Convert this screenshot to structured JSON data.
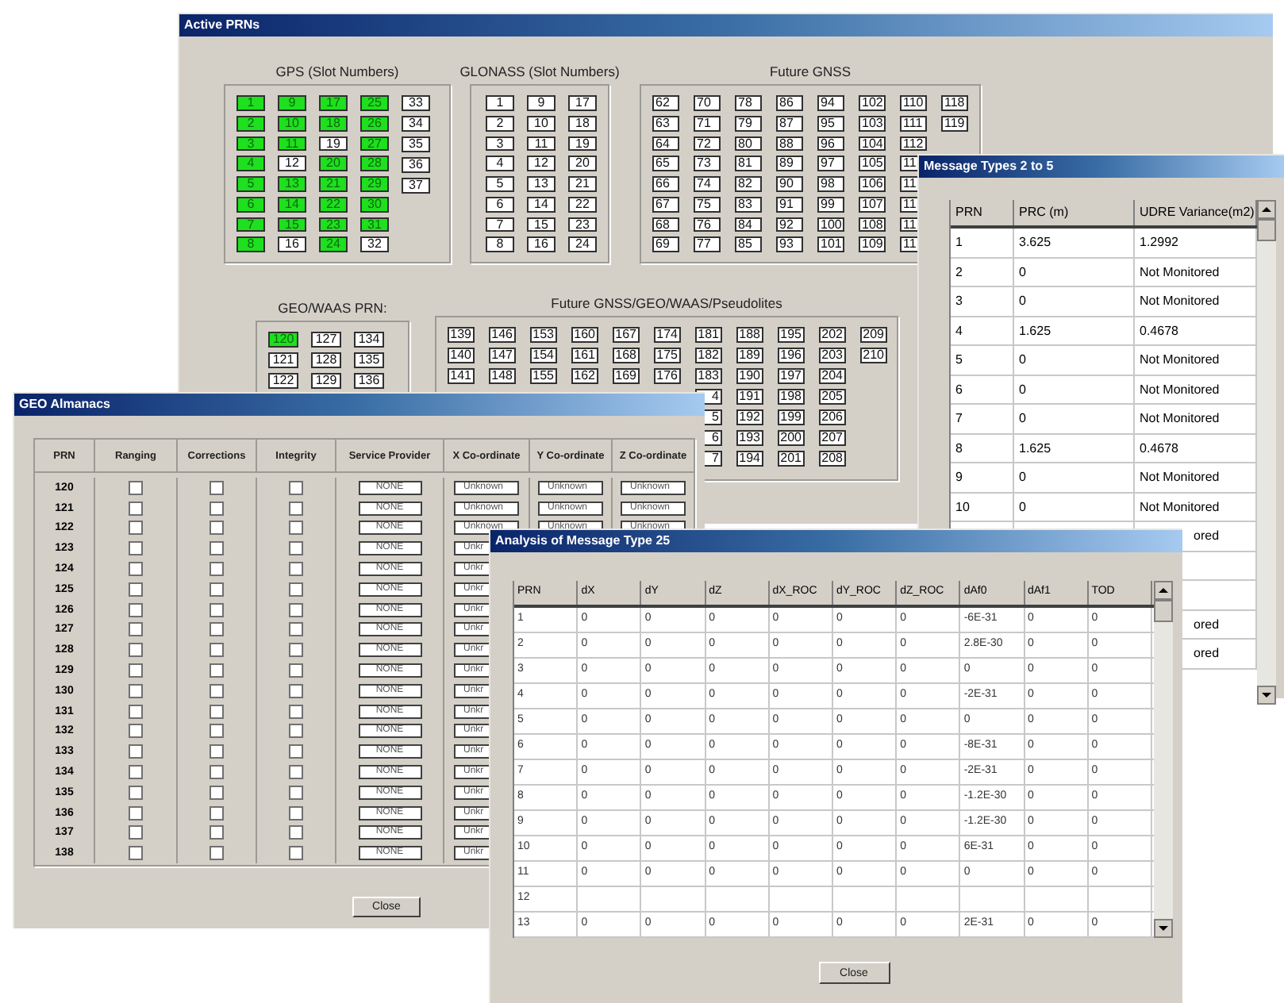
{
  "active_prns": {
    "title": "Active PRNs",
    "top_groups": [
      {
        "label": "GPS (Slot Numbers)",
        "columns": [
          [
            {
              "n": "1",
              "on": true
            },
            {
              "n": "2",
              "on": true
            },
            {
              "n": "3",
              "on": true
            },
            {
              "n": "4",
              "on": true
            },
            {
              "n": "5",
              "on": true
            },
            {
              "n": "6",
              "on": true
            },
            {
              "n": "7",
              "on": true
            },
            {
              "n": "8",
              "on": true
            }
          ],
          [
            {
              "n": "9",
              "on": true
            },
            {
              "n": "10",
              "on": true
            },
            {
              "n": "11",
              "on": true
            },
            {
              "n": "12",
              "on": false
            },
            {
              "n": "13",
              "on": true
            },
            {
              "n": "14",
              "on": true
            },
            {
              "n": "15",
              "on": true
            },
            {
              "n": "16",
              "on": false
            }
          ],
          [
            {
              "n": "17",
              "on": true
            },
            {
              "n": "18",
              "on": true
            },
            {
              "n": "19",
              "on": false
            },
            {
              "n": "20",
              "on": true
            },
            {
              "n": "21",
              "on": true
            },
            {
              "n": "22",
              "on": true
            },
            {
              "n": "23",
              "on": true
            },
            {
              "n": "24",
              "on": true
            }
          ],
          [
            {
              "n": "25",
              "on": true
            },
            {
              "n": "26",
              "on": true
            },
            {
              "n": "27",
              "on": true
            },
            {
              "n": "28",
              "on": true
            },
            {
              "n": "29",
              "on": true
            },
            {
              "n": "30",
              "on": true
            },
            {
              "n": "31",
              "on": true
            },
            {
              "n": "32",
              "on": false
            }
          ],
          [
            {
              "n": "33",
              "on": false
            },
            {
              "n": "34",
              "on": false
            },
            {
              "n": "35",
              "on": false
            },
            {
              "n": "36",
              "on": false
            },
            {
              "n": "37",
              "on": false
            }
          ]
        ]
      },
      {
        "label": "GLONASS (Slot Numbers)",
        "columns": [
          [
            {
              "n": "1",
              "on": false
            },
            {
              "n": "2",
              "on": false
            },
            {
              "n": "3",
              "on": false
            },
            {
              "n": "4",
              "on": false
            },
            {
              "n": "5",
              "on": false
            },
            {
              "n": "6",
              "on": false
            },
            {
              "n": "7",
              "on": false
            },
            {
              "n": "8",
              "on": false
            }
          ],
          [
            {
              "n": "9",
              "on": false
            },
            {
              "n": "10",
              "on": false
            },
            {
              "n": "11",
              "on": false
            },
            {
              "n": "12",
              "on": false
            },
            {
              "n": "13",
              "on": false
            },
            {
              "n": "14",
              "on": false
            },
            {
              "n": "15",
              "on": false
            },
            {
              "n": "16",
              "on": false
            }
          ],
          [
            {
              "n": "17",
              "on": false
            },
            {
              "n": "18",
              "on": false
            },
            {
              "n": "19",
              "on": false
            },
            {
              "n": "20",
              "on": false
            },
            {
              "n": "21",
              "on": false
            },
            {
              "n": "22",
              "on": false
            },
            {
              "n": "23",
              "on": false
            },
            {
              "n": "24",
              "on": false
            }
          ]
        ]
      },
      {
        "label": "Future GNSS",
        "columns": [
          [
            {
              "n": "62",
              "on": false
            },
            {
              "n": "63",
              "on": false
            },
            {
              "n": "64",
              "on": false
            },
            {
              "n": "65",
              "on": false
            },
            {
              "n": "66",
              "on": false
            },
            {
              "n": "67",
              "on": false
            },
            {
              "n": "68",
              "on": false
            },
            {
              "n": "69",
              "on": false
            }
          ],
          [
            {
              "n": "70",
              "on": false
            },
            {
              "n": "71",
              "on": false
            },
            {
              "n": "72",
              "on": false
            },
            {
              "n": "73",
              "on": false
            },
            {
              "n": "74",
              "on": false
            },
            {
              "n": "75",
              "on": false
            },
            {
              "n": "76",
              "on": false
            },
            {
              "n": "77",
              "on": false
            }
          ],
          [
            {
              "n": "78",
              "on": false
            },
            {
              "n": "79",
              "on": false
            },
            {
              "n": "80",
              "on": false
            },
            {
              "n": "81",
              "on": false
            },
            {
              "n": "82",
              "on": false
            },
            {
              "n": "83",
              "on": false
            },
            {
              "n": "84",
              "on": false
            },
            {
              "n": "85",
              "on": false
            }
          ],
          [
            {
              "n": "86",
              "on": false
            },
            {
              "n": "87",
              "on": false
            },
            {
              "n": "88",
              "on": false
            },
            {
              "n": "89",
              "on": false
            },
            {
              "n": "90",
              "on": false
            },
            {
              "n": "91",
              "on": false
            },
            {
              "n": "92",
              "on": false
            },
            {
              "n": "93",
              "on": false
            }
          ],
          [
            {
              "n": "94",
              "on": false
            },
            {
              "n": "95",
              "on": false
            },
            {
              "n": "96",
              "on": false
            },
            {
              "n": "97",
              "on": false
            },
            {
              "n": "98",
              "on": false
            },
            {
              "n": "99",
              "on": false
            },
            {
              "n": "100",
              "on": false
            },
            {
              "n": "101",
              "on": false
            }
          ],
          [
            {
              "n": "102",
              "on": false
            },
            {
              "n": "103",
              "on": false
            },
            {
              "n": "104",
              "on": false
            },
            {
              "n": "105",
              "on": false
            },
            {
              "n": "106",
              "on": false
            },
            {
              "n": "107",
              "on": false
            },
            {
              "n": "108",
              "on": false
            },
            {
              "n": "109",
              "on": false
            }
          ],
          [
            {
              "n": "110",
              "on": false
            },
            {
              "n": "111",
              "on": false
            },
            {
              "n": "112",
              "on": false
            },
            {
              "n": "11",
              "on": false
            },
            {
              "n": "11",
              "on": false
            },
            {
              "n": "11",
              "on": false
            },
            {
              "n": "11",
              "on": false
            },
            {
              "n": "11",
              "on": false
            }
          ],
          [
            {
              "n": "118",
              "on": false
            },
            {
              "n": "119",
              "on": false
            }
          ]
        ]
      }
    ],
    "bottom_groups": [
      {
        "label": "GEO/WAAS PRN:",
        "columns": [
          [
            {
              "n": "120",
              "on": true
            },
            {
              "n": "121",
              "on": false
            },
            {
              "n": "122",
              "on": false
            }
          ],
          [
            {
              "n": "127",
              "on": false
            },
            {
              "n": "128",
              "on": false
            },
            {
              "n": "129",
              "on": false
            }
          ],
          [
            {
              "n": "134",
              "on": false
            },
            {
              "n": "135",
              "on": false
            },
            {
              "n": "136",
              "on": false
            }
          ]
        ]
      },
      {
        "label": "Future GNSS/GEO/WAAS/Pseudolites",
        "columns": [
          [
            {
              "n": "139",
              "on": false
            },
            {
              "n": "140",
              "on": false
            },
            {
              "n": "141",
              "on": false
            }
          ],
          [
            {
              "n": "146",
              "on": false
            },
            {
              "n": "147",
              "on": false
            },
            {
              "n": "148",
              "on": false
            }
          ],
          [
            {
              "n": "153",
              "on": false
            },
            {
              "n": "154",
              "on": false
            },
            {
              "n": "155",
              "on": false
            }
          ],
          [
            {
              "n": "160",
              "on": false
            },
            {
              "n": "161",
              "on": false
            },
            {
              "n": "162",
              "on": false
            }
          ],
          [
            {
              "n": "167",
              "on": false
            },
            {
              "n": "168",
              "on": false
            },
            {
              "n": "169",
              "on": false
            }
          ],
          [
            {
              "n": "174",
              "on": false
            },
            {
              "n": "175",
              "on": false
            },
            {
              "n": "176",
              "on": false
            }
          ],
          [
            {
              "n": "181",
              "on": false
            },
            {
              "n": "182",
              "on": false
            },
            {
              "n": "183",
              "on": false
            },
            {
              "n": "4",
              "on": false
            },
            {
              "n": "5",
              "on": false
            },
            {
              "n": "6",
              "on": false
            },
            {
              "n": "7",
              "on": false
            }
          ],
          [
            {
              "n": "188",
              "on": false
            },
            {
              "n": "189",
              "on": false
            },
            {
              "n": "190",
              "on": false
            },
            {
              "n": "191",
              "on": false
            },
            {
              "n": "192",
              "on": false
            },
            {
              "n": "193",
              "on": false
            },
            {
              "n": "194",
              "on": false
            }
          ],
          [
            {
              "n": "195",
              "on": false
            },
            {
              "n": "196",
              "on": false
            },
            {
              "n": "197",
              "on": false
            },
            {
              "n": "198",
              "on": false
            },
            {
              "n": "199",
              "on": false
            },
            {
              "n": "200",
              "on": false
            },
            {
              "n": "201",
              "on": false
            }
          ],
          [
            {
              "n": "202",
              "on": false
            },
            {
              "n": "203",
              "on": false
            },
            {
              "n": "204",
              "on": false
            },
            {
              "n": "205",
              "on": false
            },
            {
              "n": "206",
              "on": false
            },
            {
              "n": "207",
              "on": false
            },
            {
              "n": "208",
              "on": false
            }
          ],
          [
            {
              "n": "209",
              "on": false
            },
            {
              "n": "210",
              "on": false
            }
          ]
        ]
      }
    ]
  },
  "message_types": {
    "title": "Message Types 2 to 5",
    "columns": [
      "PRN",
      "PRC (m)",
      "UDRE Variance(m2)"
    ],
    "rows": [
      {
        "prn": "1",
        "prc": "3.625",
        "udre": "1.2992"
      },
      {
        "prn": "2",
        "prc": "0",
        "udre": "Not Monitored"
      },
      {
        "prn": "3",
        "prc": "0",
        "udre": "Not Monitored"
      },
      {
        "prn": "4",
        "prc": "1.625",
        "udre": "0.4678"
      },
      {
        "prn": "5",
        "prc": "0",
        "udre": "Not Monitored"
      },
      {
        "prn": "6",
        "prc": "0",
        "udre": "Not Monitored"
      },
      {
        "prn": "7",
        "prc": "0",
        "udre": "Not Monitored"
      },
      {
        "prn": "8",
        "prc": "1.625",
        "udre": "0.4678"
      },
      {
        "prn": "9",
        "prc": "0",
        "udre": "Not Monitored"
      },
      {
        "prn": "10",
        "prc": "0",
        "udre": "Not Monitored"
      },
      {
        "udre": "ored"
      },
      {},
      {},
      {
        "udre": "ored"
      },
      {
        "udre": "ored"
      }
    ]
  },
  "geo_almanacs": {
    "title": "GEO Almanacs",
    "columns": [
      "PRN",
      "Ranging",
      "Corrections",
      "Integrity",
      "Service Provider",
      "X Co-ordinate",
      "Y Co-ordinate",
      "Z Co-ordinate"
    ],
    "rows": [
      {
        "prn": "120",
        "ranging": false,
        "corrections": false,
        "integrity": false,
        "provider": "NONE",
        "x": "Unknown",
        "y": "Unknown",
        "z": "Unknown"
      },
      {
        "prn": "121",
        "ranging": false,
        "corrections": false,
        "integrity": false,
        "provider": "NONE",
        "x": "Unknown",
        "y": "Unknown",
        "z": "Unknown"
      },
      {
        "prn": "122",
        "ranging": false,
        "corrections": false,
        "integrity": false,
        "provider": "NONE",
        "x": "Unknown",
        "y": "Unknown",
        "z": "Unknown"
      },
      {
        "prn": "123",
        "ranging": false,
        "corrections": false,
        "integrity": false,
        "provider": "NONE",
        "x": "Unkr"
      },
      {
        "prn": "124",
        "ranging": false,
        "corrections": false,
        "integrity": false,
        "provider": "NONE",
        "x": "Unkr"
      },
      {
        "prn": "125",
        "ranging": false,
        "corrections": false,
        "integrity": false,
        "provider": "NONE",
        "x": "Unkr"
      },
      {
        "prn": "126",
        "ranging": false,
        "corrections": false,
        "integrity": false,
        "provider": "NONE",
        "x": "Unkr"
      },
      {
        "prn": "127",
        "ranging": false,
        "corrections": false,
        "integrity": false,
        "provider": "NONE",
        "x": "Unkr"
      },
      {
        "prn": "128",
        "ranging": false,
        "corrections": false,
        "integrity": false,
        "provider": "NONE",
        "x": "Unkr"
      },
      {
        "prn": "129",
        "ranging": false,
        "corrections": false,
        "integrity": false,
        "provider": "NONE",
        "x": "Unkr"
      },
      {
        "prn": "130",
        "ranging": false,
        "corrections": false,
        "integrity": false,
        "provider": "NONE",
        "x": "Unkr"
      },
      {
        "prn": "131",
        "ranging": false,
        "corrections": false,
        "integrity": false,
        "provider": "NONE",
        "x": "Unkr"
      },
      {
        "prn": "132",
        "ranging": false,
        "corrections": false,
        "integrity": false,
        "provider": "NONE",
        "x": "Unkr"
      },
      {
        "prn": "133",
        "ranging": false,
        "corrections": false,
        "integrity": false,
        "provider": "NONE",
        "x": "Unkr"
      },
      {
        "prn": "134",
        "ranging": false,
        "corrections": false,
        "integrity": false,
        "provider": "NONE",
        "x": "Unkr"
      },
      {
        "prn": "135",
        "ranging": false,
        "corrections": false,
        "integrity": false,
        "provider": "NONE",
        "x": "Unkr"
      },
      {
        "prn": "136",
        "ranging": false,
        "corrections": false,
        "integrity": false,
        "provider": "NONE",
        "x": "Unkr"
      },
      {
        "prn": "137",
        "ranging": false,
        "corrections": false,
        "integrity": false,
        "provider": "NONE",
        "x": "Unkr"
      },
      {
        "prn": "138",
        "ranging": false,
        "corrections": false,
        "integrity": false,
        "provider": "NONE",
        "x": "Unkr"
      }
    ],
    "button": "Close"
  },
  "analysis_mt25": {
    "title": "Analysis of Message Type 25",
    "columns": [
      "PRN",
      "dX",
      "dY",
      "dZ",
      "dX_ROC",
      "dY_ROC",
      "dZ_ROC",
      "dAf0",
      "dAf1",
      "TOD"
    ],
    "rows": [
      [
        "1",
        "0",
        "0",
        "0",
        "0",
        "0",
        "0",
        "-6E-31",
        "0",
        "0"
      ],
      [
        "2",
        "0",
        "0",
        "0",
        "0",
        "0",
        "0",
        "2.8E-30",
        "0",
        "0"
      ],
      [
        "3",
        "0",
        "0",
        "0",
        "0",
        "0",
        "0",
        "0",
        "0",
        "0"
      ],
      [
        "4",
        "0",
        "0",
        "0",
        "0",
        "0",
        "0",
        "-2E-31",
        "0",
        "0"
      ],
      [
        "5",
        "0",
        "0",
        "0",
        "0",
        "0",
        "0",
        "0",
        "0",
        "0"
      ],
      [
        "6",
        "0",
        "0",
        "0",
        "0",
        "0",
        "0",
        "-8E-31",
        "0",
        "0"
      ],
      [
        "7",
        "0",
        "0",
        "0",
        "0",
        "0",
        "0",
        "-2E-31",
        "0",
        "0"
      ],
      [
        "8",
        "0",
        "0",
        "0",
        "0",
        "0",
        "0",
        "-1.2E-30",
        "0",
        "0"
      ],
      [
        "9",
        "0",
        "0",
        "0",
        "0",
        "0",
        "0",
        "-1.2E-30",
        "0",
        "0"
      ],
      [
        "10",
        "0",
        "0",
        "0",
        "0",
        "0",
        "0",
        "6E-31",
        "0",
        "0"
      ],
      [
        "11",
        "0",
        "0",
        "0",
        "0",
        "0",
        "0",
        "0",
        "0",
        "0"
      ],
      [
        "12"
      ],
      [
        "13",
        "0",
        "0",
        "0",
        "0",
        "0",
        "0",
        "2E-31",
        "0",
        "0"
      ]
    ],
    "button": "Close"
  }
}
